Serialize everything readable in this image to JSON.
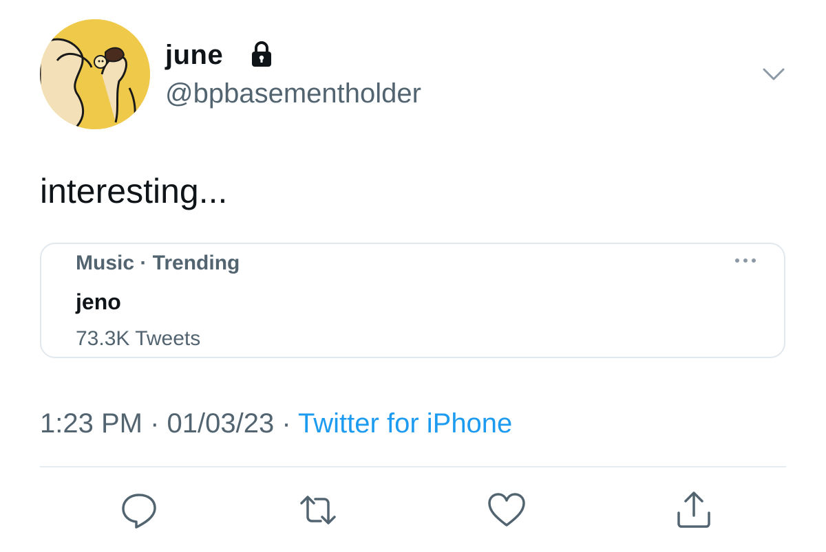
{
  "author": {
    "display_name": "june",
    "handle": "@bpbasementholder",
    "protected": true
  },
  "tweet": {
    "text": "interesting..."
  },
  "trend_card": {
    "context": "Music · Trending",
    "topic": "jeno",
    "count": "73.3K Tweets"
  },
  "meta": {
    "time": "1:23 PM",
    "separator": " · ",
    "date": "01/03/23",
    "source": "Twitter for iPhone"
  },
  "actions": [
    "reply-icon",
    "retweet-icon",
    "like-icon",
    "share-icon"
  ],
  "colors": {
    "text": "#0f1419",
    "secondary": "#536471",
    "link": "#1d9bf0",
    "border": "#e1e8ed",
    "avatar_bg": "#efc94a"
  }
}
